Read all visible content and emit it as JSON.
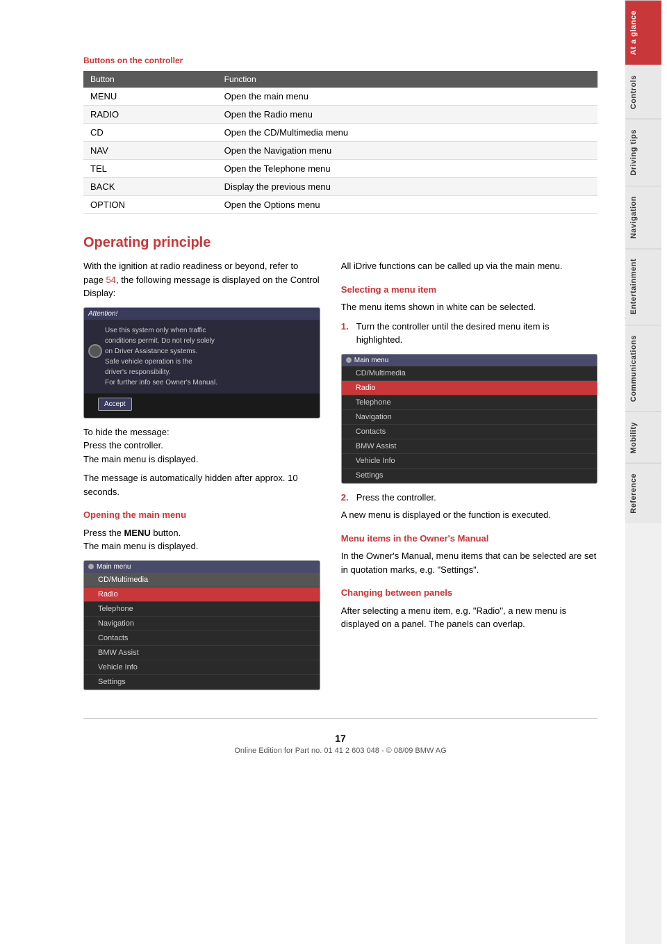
{
  "page": {
    "number": "17",
    "footer_text": "Online Edition for Part no. 01 41 2 603 048 - © 08/09 BMW AG"
  },
  "sidebar": {
    "tabs": [
      {
        "id": "at-a-glance",
        "label": "At a glance",
        "active": true
      },
      {
        "id": "controls",
        "label": "Controls",
        "active": false
      },
      {
        "id": "driving-tips",
        "label": "Driving tips",
        "active": false
      },
      {
        "id": "navigation",
        "label": "Navigation",
        "active": false
      },
      {
        "id": "entertainment",
        "label": "Entertainment",
        "active": false
      },
      {
        "id": "communications",
        "label": "Communications",
        "active": false
      },
      {
        "id": "mobility",
        "label": "Mobility",
        "active": false
      },
      {
        "id": "reference",
        "label": "Reference",
        "active": false
      }
    ]
  },
  "buttons_section": {
    "title": "Buttons on the controller",
    "table_header": [
      "Button",
      "Function"
    ],
    "rows": [
      {
        "button": "MENU",
        "function": "Open the main menu"
      },
      {
        "button": "RADIO",
        "function": "Open the Radio menu"
      },
      {
        "button": "CD",
        "function": "Open the CD/Multimedia menu"
      },
      {
        "button": "NAV",
        "function": "Open the Navigation menu"
      },
      {
        "button": "TEL",
        "function": "Open the Telephone menu"
      },
      {
        "button": "BACK",
        "function": "Display the previous menu"
      },
      {
        "button": "OPTION",
        "function": "Open the Options menu"
      }
    ]
  },
  "operating_principle": {
    "title": "Operating principle",
    "intro_text": "With the ignition at radio readiness or beyond, refer to page ",
    "intro_link": "54",
    "intro_text2": ", the following message is displayed on the Control Display:",
    "attention_box": {
      "header": "Attention!",
      "lines": [
        "Use this system only when traffic",
        "conditions permit. Do not rely solely",
        "on Driver Assistance systems.",
        "Safe vehicle operation is the",
        "driver's responsibility.",
        "For further info see Owner's Manual."
      ],
      "accept_label": "Accept"
    },
    "hide_message_text": [
      "To hide the message:",
      "Press the controller.",
      "The main menu is displayed."
    ],
    "auto_hidden_text": "The message is automatically hidden after approx. 10 seconds.",
    "opening_main_menu": {
      "title": "Opening the main menu",
      "text1": "Press the ",
      "bold": "MENU",
      "text2": " button.",
      "text3": "The main menu is displayed."
    },
    "main_menu_screen": {
      "header": "Main menu",
      "items": [
        {
          "label": "CD/Multimedia",
          "style": "selected"
        },
        {
          "label": "Radio",
          "style": "highlighted"
        },
        {
          "label": "Telephone",
          "style": "normal"
        },
        {
          "label": "Navigation",
          "style": "normal"
        },
        {
          "label": "Contacts",
          "style": "normal"
        },
        {
          "label": "BMW Assist",
          "style": "normal"
        },
        {
          "label": "Vehicle Info",
          "style": "normal"
        },
        {
          "label": "Settings",
          "style": "normal"
        }
      ]
    },
    "right_col": {
      "all_functions_text": "All iDrive functions can be called up via the main menu.",
      "selecting_item": {
        "title": "Selecting a menu item",
        "text": "The menu items shown in white can be selected."
      },
      "step1": "Turn the controller until the desired menu item is highlighted.",
      "main_menu_screen2": {
        "header": "Main menu",
        "items": [
          {
            "label": "CD/Multimedia",
            "style": "normal"
          },
          {
            "label": "Radio",
            "style": "highlighted"
          },
          {
            "label": "Telephone",
            "style": "normal"
          },
          {
            "label": "Navigation",
            "style": "normal"
          },
          {
            "label": "Contacts",
            "style": "normal"
          },
          {
            "label": "BMW Assist",
            "style": "normal"
          },
          {
            "label": "Vehicle Info",
            "style": "normal"
          },
          {
            "label": "Settings",
            "style": "normal"
          }
        ]
      },
      "step2": "Press the controller.",
      "new_menu_text": "A new menu is displayed or the function is executed.",
      "menu_owners_manual": {
        "title": "Menu items in the Owner's Manual",
        "text": "In the Owner's Manual, menu items that can be selected are set in quotation marks, e.g. \"Settings\"."
      },
      "changing_panels": {
        "title": "Changing between panels",
        "text": "After selecting a menu item, e.g. \"Radio\", a new menu is displayed on a panel. The panels can overlap."
      }
    }
  }
}
